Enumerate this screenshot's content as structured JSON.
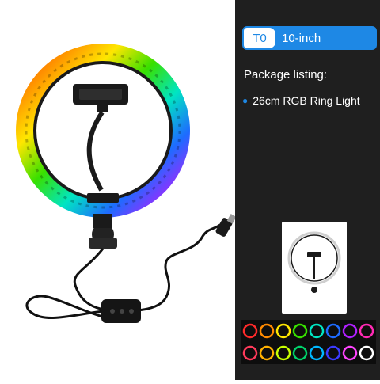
{
  "variant": {
    "code": "T0",
    "name": "10-inch"
  },
  "package": {
    "title": "Package listing:",
    "items": [
      "26cm RGB Ring Light"
    ]
  },
  "colors": {
    "panel": "#1f1f1f",
    "accent": "#1e88e5"
  },
  "swatch_colors": [
    "#ff2a2a",
    "#ff8a00",
    "#ffe600",
    "#38e000",
    "#00e5c2",
    "#1e6bff",
    "#b020ff",
    "#ff2ab4",
    "#ff3a5a",
    "#ffb000",
    "#c8ff00",
    "#00d26a",
    "#00b7ff",
    "#3b3bff",
    "#ff44ff",
    "#ffffff"
  ]
}
